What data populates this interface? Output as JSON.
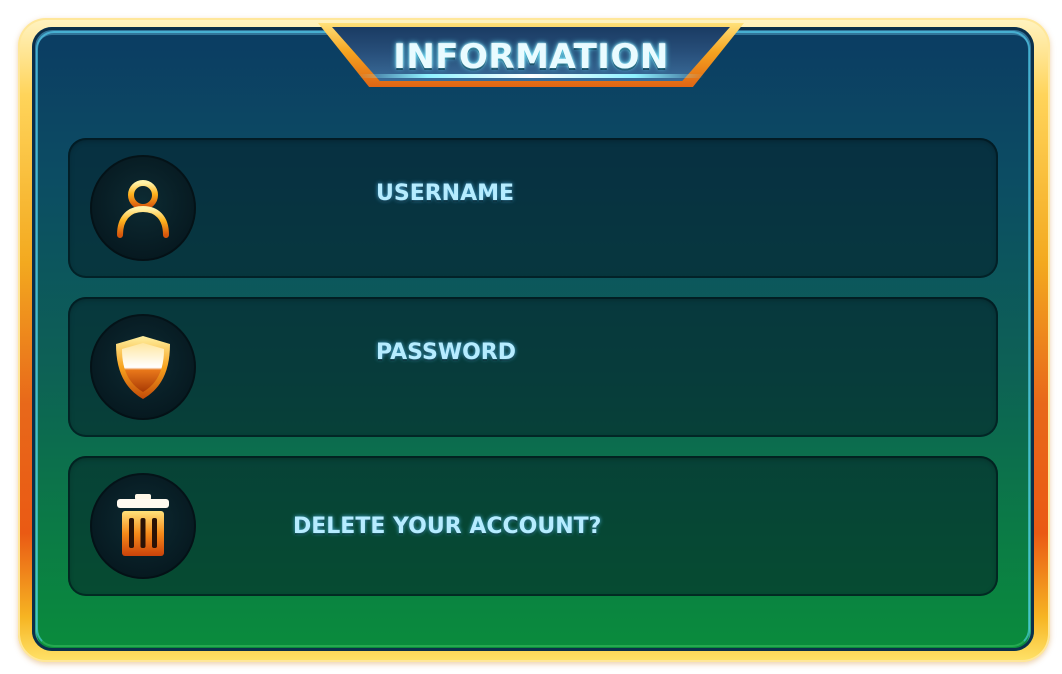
{
  "dialog": {
    "title": "INFORMATION"
  },
  "rows": [
    {
      "label": "USERNAME",
      "icon": "user-icon"
    },
    {
      "label": "PASSWORD",
      "icon": "shield-icon"
    },
    {
      "label": "DELETE YOUR ACCOUNT?",
      "icon": "trash-icon"
    }
  ],
  "colors": {
    "frame_gold": "#f6a420",
    "frame_orange": "#e8681a",
    "panel_top": "#0b3c63",
    "panel_bottom": "#0a8c3c",
    "label_text": "#b6ecff",
    "title_text": "#e9fbff"
  }
}
